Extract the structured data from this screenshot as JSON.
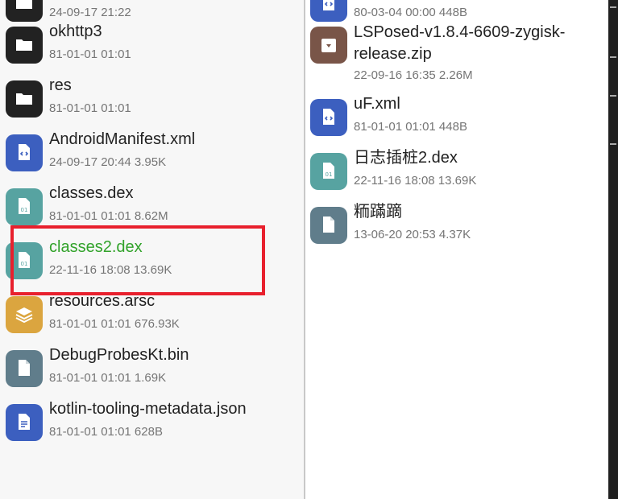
{
  "left_list": [
    {
      "name": "",
      "meta": "24-09-17 21:22",
      "icon": "folder-icon",
      "color": "#222222"
    },
    {
      "name": "okhttp3",
      "meta": "81-01-01 01:01",
      "icon": "folder-icon",
      "color": "#222222"
    },
    {
      "name": "res",
      "meta": "81-01-01 01:01",
      "icon": "folder-icon",
      "color": "#222222"
    },
    {
      "name": "AndroidManifest.xml",
      "meta": "24-09-17 20:44  3.95K",
      "icon": "code-file-icon",
      "color": "#3c5fbf"
    },
    {
      "name": "classes.dex",
      "meta": "81-01-01 01:01  8.62M",
      "icon": "binary-file-icon",
      "color": "#57a3a1"
    },
    {
      "name": "classes2.dex",
      "meta": "22-11-16 18:08  13.69K",
      "icon": "binary-file-icon",
      "color": "#57a3a1"
    },
    {
      "name": "resources.arsc",
      "meta": "81-01-01 01:01  676.93K",
      "icon": "layers-icon",
      "color": "#dba53f"
    },
    {
      "name": "DebugProbesKt.bin",
      "meta": "81-01-01 01:01  1.69K",
      "icon": "file-icon",
      "color": "#607d8b"
    },
    {
      "name": "kotlin-tooling-metadata.json",
      "meta": "81-01-01 01:01  628B",
      "icon": "document-icon",
      "color": "#3c5fbf"
    }
  ],
  "right_list": [
    {
      "name": "",
      "meta": "80-03-04 00:00  448B",
      "icon": "code-file-icon",
      "color": "#3c5fbf"
    },
    {
      "name": "LSPosed-v1.8.4-6609-zygisk-release.zip",
      "meta": "22-09-16 16:35  2.26M",
      "icon": "archive-icon",
      "color": "#795548"
    },
    {
      "name": "uF.xml",
      "meta": "81-01-01 01:01  448B",
      "icon": "code-file-icon",
      "color": "#3c5fbf"
    },
    {
      "name": "日志插桩2.dex",
      "meta": "22-11-16 18:08  13.69K",
      "icon": "binary-file-icon",
      "color": "#57a3a1"
    },
    {
      "name": "粫蹣蹢",
      "meta": "13-06-20 20:53  4.37K",
      "icon": "file-icon",
      "color": "#607d8b"
    }
  ],
  "highlighted_index": 5
}
